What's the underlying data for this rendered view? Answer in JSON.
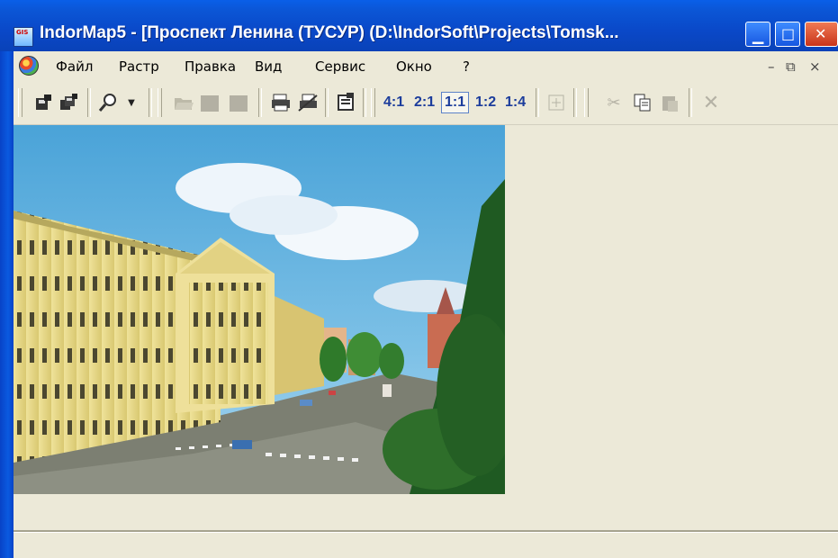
{
  "window": {
    "title": "IndorMap5 - [Проспект Ленина (ТУСУР) (D:\\IndorSoft\\Projects\\Tomsk...",
    "app_icon_text": "GIS"
  },
  "menu": {
    "items": [
      "Файл",
      "Растр",
      "Правка",
      "Вид",
      "Сервис",
      "Окно",
      "?"
    ]
  },
  "toolbar": {
    "zoom_levels": [
      "4:1",
      "2:1",
      "1:1",
      "1:2",
      "1:4"
    ],
    "active_zoom": "1:1"
  },
  "colors": {
    "titlebar": "#0A4FD6",
    "chrome": "#ECE9D8",
    "zoom_text": "#1C3D9C"
  }
}
